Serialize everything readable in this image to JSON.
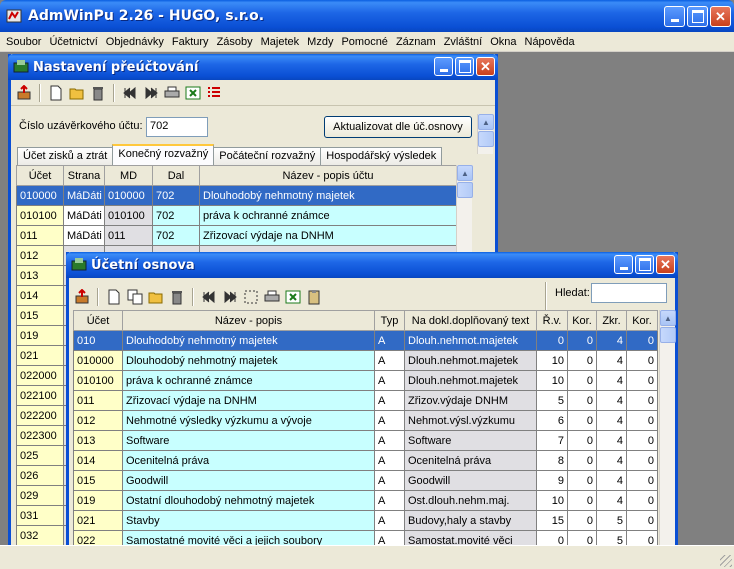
{
  "app": {
    "title": "AdmWinPu 2.26 - HUGO, s.r.o.",
    "menu": [
      "Soubor",
      "Účetnictví",
      "Objednávky",
      "Faktury",
      "Zásoby",
      "Majetek",
      "Mzdy",
      "Pomocné",
      "Záznam",
      "Zvláštní",
      "Okna",
      "Nápověda"
    ]
  },
  "w1": {
    "title": "Nastavení přeúčtování",
    "closing_account_label": "Číslo uzávěrkového účtu:",
    "closing_account_value": "702",
    "update_button": "Aktualizovat dle úč.osnovy",
    "tabs": [
      "Účet zisků a ztrát",
      "Konečný rozvažný",
      "Počáteční rozvažný",
      "Hospodářský výsledek"
    ],
    "active_tab": 1,
    "columns": [
      "Účet",
      "Strana",
      "MD",
      "Dal",
      "Název - popis účtu"
    ],
    "rows": [
      [
        "010000",
        "MáDáti",
        "010000",
        "702",
        "Dlouhodobý nehmotný majetek"
      ],
      [
        "010100",
        "MáDáti",
        "010100",
        "702",
        "práva k ochranné známce"
      ],
      [
        "011",
        "MáDáti",
        "011",
        "702",
        "Zřizovací výdaje na DNHM"
      ],
      [
        "012",
        "",
        "",
        "",
        ""
      ],
      [
        "013",
        "",
        "",
        "",
        ""
      ],
      [
        "014",
        "",
        "",
        "",
        ""
      ],
      [
        "015",
        "",
        "",
        "",
        ""
      ],
      [
        "019",
        "",
        "",
        "",
        ""
      ],
      [
        "021",
        "",
        "",
        "",
        ""
      ],
      [
        "022000",
        "",
        "",
        "",
        ""
      ],
      [
        "022100",
        "",
        "",
        "",
        ""
      ],
      [
        "022200",
        "",
        "",
        "",
        ""
      ],
      [
        "022300",
        "",
        "",
        "",
        ""
      ],
      [
        "025",
        "",
        "",
        "",
        ""
      ],
      [
        "026",
        "",
        "",
        "",
        ""
      ],
      [
        "029",
        "",
        "",
        "",
        ""
      ],
      [
        "031",
        "",
        "",
        "",
        ""
      ],
      [
        "032",
        "",
        "",
        "",
        ""
      ]
    ]
  },
  "w2": {
    "title": "Účetní osnova",
    "search_label": "Hledat:",
    "search_value": "",
    "columns": [
      "Účet",
      "Název - popis",
      "Typ",
      "Na dokl.doplňovaný text",
      "Ř.v.",
      "Kor.",
      "Zkr.",
      "Kor."
    ],
    "rows": [
      [
        "010",
        "Dlouhodobý nehmotný majetek",
        "A",
        "Dlouh.nehmot.majetek",
        "0",
        "0",
        "4",
        "0"
      ],
      [
        "010000",
        "Dlouhodobý nehmotný majetek",
        "A",
        "Dlouh.nehmot.majetek",
        "10",
        "0",
        "4",
        "0"
      ],
      [
        "010100",
        "práva k ochranné známce",
        "A",
        "Dlouh.nehmot.majetek",
        "10",
        "0",
        "4",
        "0"
      ],
      [
        "011",
        "Zřizovací výdaje na DNHM",
        "A",
        "Zřizov.výdaje DNHM",
        "5",
        "0",
        "4",
        "0"
      ],
      [
        "012",
        "Nehmotné výsledky výzkumu a vývoje",
        "A",
        "Nehmot.výsl.výzkumu",
        "6",
        "0",
        "4",
        "0"
      ],
      [
        "013",
        "Software",
        "A",
        "Software",
        "7",
        "0",
        "4",
        "0"
      ],
      [
        "014",
        "Ocenitelná práva",
        "A",
        "Ocenitelná práva",
        "8",
        "0",
        "4",
        "0"
      ],
      [
        "015",
        "Goodwill",
        "A",
        "Goodwill",
        "9",
        "0",
        "4",
        "0"
      ],
      [
        "019",
        "Ostatní dlouhodobý nehmotný majetek",
        "A",
        "Ost.dlouh.nehm.maj.",
        "10",
        "0",
        "4",
        "0"
      ],
      [
        "021",
        "Stavby",
        "A",
        "Budovy,haly a stavby",
        "15",
        "0",
        "5",
        "0"
      ],
      [
        "022",
        "Samostatné movité věci a jejich soubory",
        "A",
        "Samostat.movité věci",
        "0",
        "0",
        "5",
        "0"
      ]
    ]
  }
}
